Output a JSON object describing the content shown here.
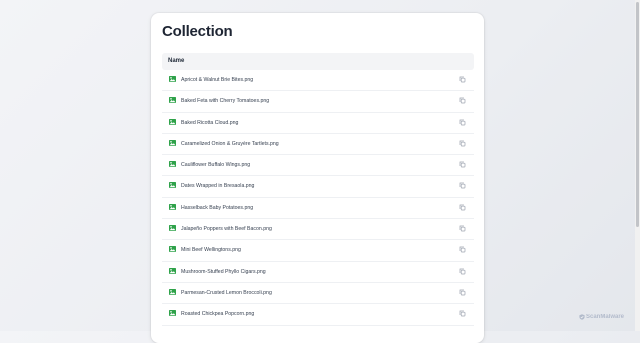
{
  "page": {
    "title": "Collection"
  },
  "table": {
    "column_name": "Name"
  },
  "files": [
    {
      "name": "Apricot & Walnut Brie Bites.png",
      "icon": "image-file-icon",
      "action_icon": "copy-icon"
    },
    {
      "name": "Baked Feta with Cherry Tomatoes.png",
      "icon": "image-file-icon",
      "action_icon": "copy-icon"
    },
    {
      "name": "Baked Ricotta Cloud.png",
      "icon": "image-file-icon",
      "action_icon": "copy-icon"
    },
    {
      "name": "Caramelized Onion & Gruyère Tartlets.png",
      "icon": "image-file-icon",
      "action_icon": "copy-icon"
    },
    {
      "name": "Cauliflower Buffalo Wings.png",
      "icon": "image-file-icon",
      "action_icon": "copy-icon"
    },
    {
      "name": "Dates Wrapped in Bresaola.png",
      "icon": "image-file-icon",
      "action_icon": "copy-icon"
    },
    {
      "name": "Hasselback Baby Potatoes.png",
      "icon": "image-file-icon",
      "action_icon": "copy-icon"
    },
    {
      "name": "Jalapeño Poppers with Beef Bacon.png",
      "icon": "image-file-icon",
      "action_icon": "copy-icon"
    },
    {
      "name": "Mini Beef Wellingtons.png",
      "icon": "image-file-icon",
      "action_icon": "copy-icon"
    },
    {
      "name": "Mushroom-Stuffed Phyllo Cigars.png",
      "icon": "image-file-icon",
      "action_icon": "copy-icon"
    },
    {
      "name": "Parmesan-Crusted Lemon Broccoli.png",
      "icon": "image-file-icon",
      "action_icon": "copy-icon"
    },
    {
      "name": "Roasted Chickpea Popcorn.png",
      "icon": "image-file-icon",
      "action_icon": "copy-icon"
    }
  ],
  "watermark": {
    "text": "ScanMalware"
  },
  "colors": {
    "file_icon": "#2fa24a",
    "title": "#1e2533",
    "header_bg": "#f3f4f6",
    "copy_icon": "#9ca3af",
    "watermark": "#8a97b1"
  }
}
